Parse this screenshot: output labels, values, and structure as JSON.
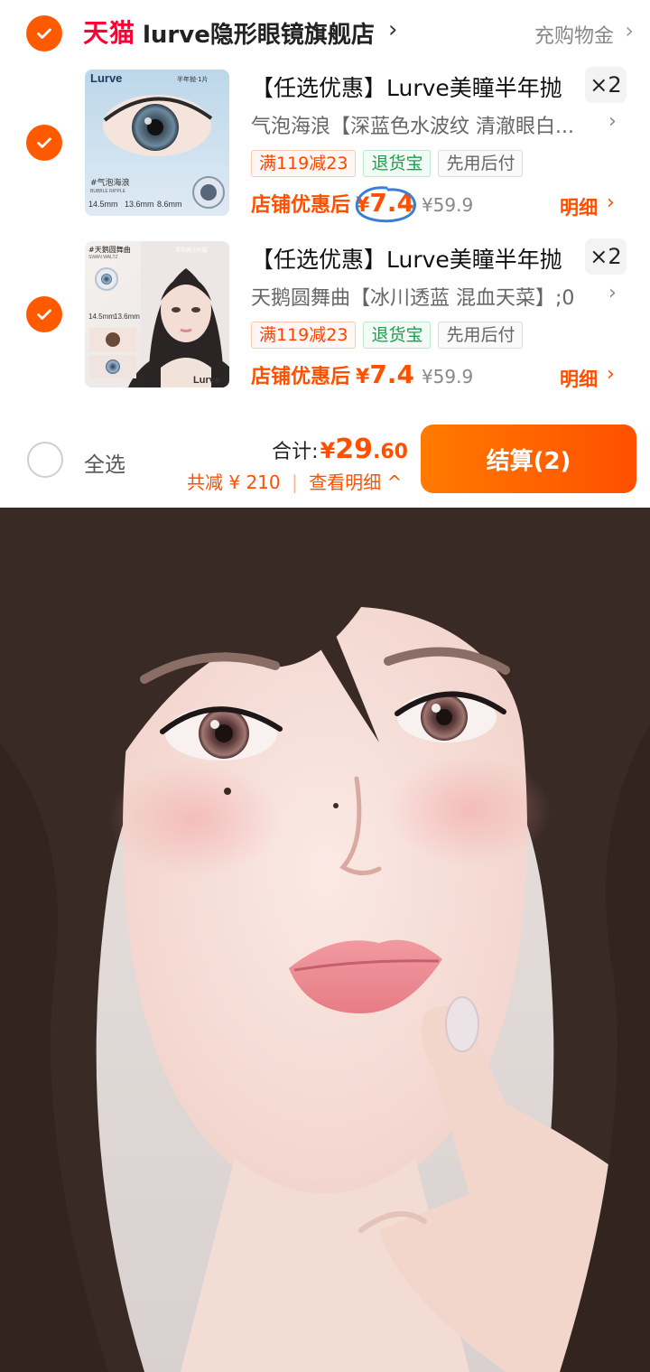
{
  "store": {
    "platform_logo": "天猫",
    "name": "lurve隐形眼镜旗舰店",
    "chevron": "›",
    "rebate_label": "充购物金",
    "rebate_chevron": "›"
  },
  "items": [
    {
      "checked": true,
      "thumb": {
        "brand": "Lurve",
        "badge": "半年抛·1片",
        "tag": "#气泡海浪",
        "tag_en": "BUBBLE RIPPLE",
        "spec1": "14.5mm",
        "spec2": "13.6mm",
        "spec3": "8.6mm"
      },
      "title": "【任选优惠】Lurve美瞳半年抛",
      "quantity": "×2",
      "sku": "气泡海浪【深蓝色水波纹 清澈眼白...",
      "sku_chevron": "›",
      "tags": [
        "满119减23",
        "退货宝",
        "先用后付"
      ],
      "price_label": "店铺优惠后",
      "price_yen": "¥",
      "price": "7.4",
      "original_price": "¥59.9",
      "detail_label": "明细",
      "detail_chevron": "›"
    },
    {
      "checked": true,
      "thumb": {
        "brand": "Lurve",
        "badge": "半年抛·1片装",
        "tag": "#天鹅圆舞曲",
        "tag_en": "SWAN WALTZ",
        "spec1": "14.5mm",
        "spec2": "13.6mm"
      },
      "title": "【任选优惠】Lurve美瞳半年抛",
      "quantity": "×2",
      "sku": "天鹅圆舞曲【冰川透蓝 混血天菜】;0",
      "sku_chevron": "›",
      "tags": [
        "满119减23",
        "退货宝",
        "先用后付"
      ],
      "price_label": "店铺优惠后",
      "price_yen": "¥",
      "price": "7.4",
      "original_price": "¥59.9",
      "detail_label": "明细",
      "detail_chevron": "›"
    }
  ],
  "footer": {
    "select_all_label": "全选",
    "total_label": "合计:",
    "total_yen": "¥",
    "total_int": "29",
    "total_dec": ".60",
    "saving_label": "共减 ¥ 210",
    "separator": "|",
    "view_detail_label": "查看明细 ^",
    "checkout_label": "结算(2)"
  },
  "colors": {
    "accent": "#ff5000",
    "tmall_red": "#ff0036",
    "green_tag": "#19a24c"
  },
  "icons": [
    "check-icon",
    "chevron-right-icon",
    "chevron-up-icon"
  ]
}
